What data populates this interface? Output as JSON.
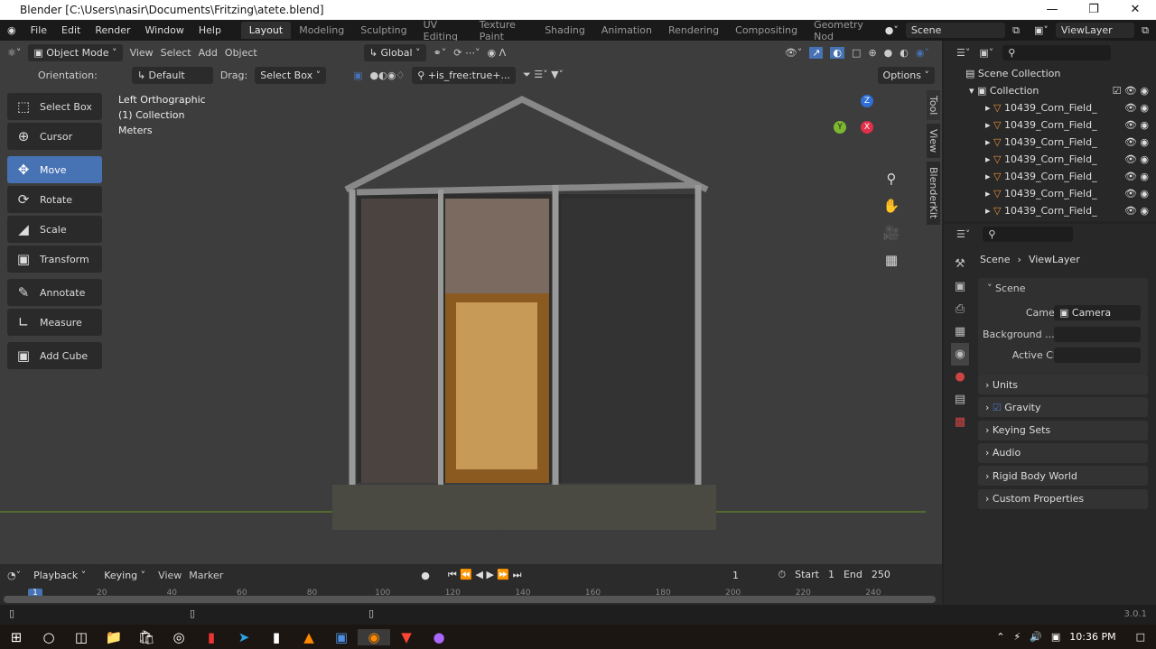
{
  "title": "Blender [C:\\Users\\nasir\\Documents\\Fritzing\\atete.blend]",
  "menu": [
    "File",
    "Edit",
    "Render",
    "Window",
    "Help"
  ],
  "workspaces": [
    "Layout",
    "Modeling",
    "Sculpting",
    "UV Editing",
    "Texture Paint",
    "Shading",
    "Animation",
    "Rendering",
    "Compositing",
    "Geometry Nod"
  ],
  "scene": "Scene",
  "viewlayer": "ViewLayer",
  "header": {
    "mode": "Object Mode",
    "view": "View",
    "select": "Select",
    "add": "Add",
    "object": "Object",
    "transform": "Global"
  },
  "toolsettings": {
    "orientation_label": "Orientation:",
    "orientation": "Default",
    "drag_label": "Drag:",
    "drag": "Select Box",
    "filter": "+is_free:true+...",
    "options": "Options"
  },
  "overlay": [
    "Left Orthographic",
    "(1) Collection",
    "Meters"
  ],
  "tools": [
    "Select Box",
    "Cursor",
    "Move",
    "Rotate",
    "Scale",
    "Transform",
    "Annotate",
    "Measure",
    "Add Cube"
  ],
  "side_tabs": [
    "Tool",
    "View",
    "BlenderKit"
  ],
  "gizmo": {
    "z": "Z",
    "y": "Y",
    "x": "X"
  },
  "outliner": {
    "root": "Scene Collection",
    "collection": "Collection",
    "items": [
      "10439_Corn_Field_",
      "10439_Corn_Field_",
      "10439_Corn_Field_",
      "10439_Corn_Field_",
      "10439_Corn_Field_",
      "10439_Corn_Field_",
      "10439_Corn_Field_"
    ]
  },
  "properties": {
    "breadcrumb_scene": "Scene",
    "breadcrumb_layer": "ViewLayer",
    "section": "Scene",
    "camera_label": "Camera",
    "camera": "Camera",
    "bg_label": "Background ...",
    "clip_label": "Active Clip",
    "panels": [
      "Units",
      "Gravity",
      "Keying Sets",
      "Audio",
      "Rigid Body World",
      "Custom Properties"
    ]
  },
  "timeline": {
    "playback": "Playback",
    "keying": "Keying",
    "view": "View",
    "marker": "Marker",
    "frame": "1",
    "start_label": "Start",
    "start": "1",
    "end_label": "End",
    "end": "250",
    "ticks": [
      "1",
      "20",
      "40",
      "60",
      "80",
      "100",
      "120",
      "140",
      "160",
      "180",
      "200",
      "220",
      "240"
    ]
  },
  "version": "3.0.1",
  "clock": "10:36 PM",
  "accent": "#4772b3"
}
